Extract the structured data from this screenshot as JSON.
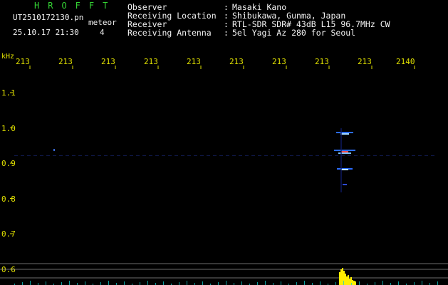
{
  "window": {
    "logo": "HROFFT",
    "filename": "UT2510172130.pn",
    "mode_label": "meteor",
    "datetime": "25.10.17 21:30",
    "count": "4"
  },
  "header": {
    "rows": [
      {
        "key": "Observer",
        "value": "Masaki Kano"
      },
      {
        "key": "Receiving Location",
        "value": "Shibukawa, Gunma, Japan"
      },
      {
        "key": "Receiver",
        "value": "RTL-SDR SDR# 43dB L15 96.7MHz CW"
      },
      {
        "key": "Receiving Antenna",
        "value": "5el Yagi Az 280 for Seoul"
      }
    ],
    "separator": ":"
  },
  "colors": {
    "background": "#000000",
    "label_green": "#34d334",
    "tick_yellow": "#e0e000",
    "text_white": "#f2f2f2",
    "signal_yellow": "#ffee00",
    "signal_blue": "#2b6cff"
  },
  "spectrogram": {
    "x_unit": "",
    "y_unit": "kHz",
    "time_ticks": [
      "213",
      "213",
      "213",
      "213",
      "213",
      "213",
      "213",
      "213",
      "213",
      "2140"
    ],
    "freq_ticks": [
      "1.1",
      "1.0",
      "0.9",
      "0.8",
      "0.7",
      "0.6"
    ]
  }
}
